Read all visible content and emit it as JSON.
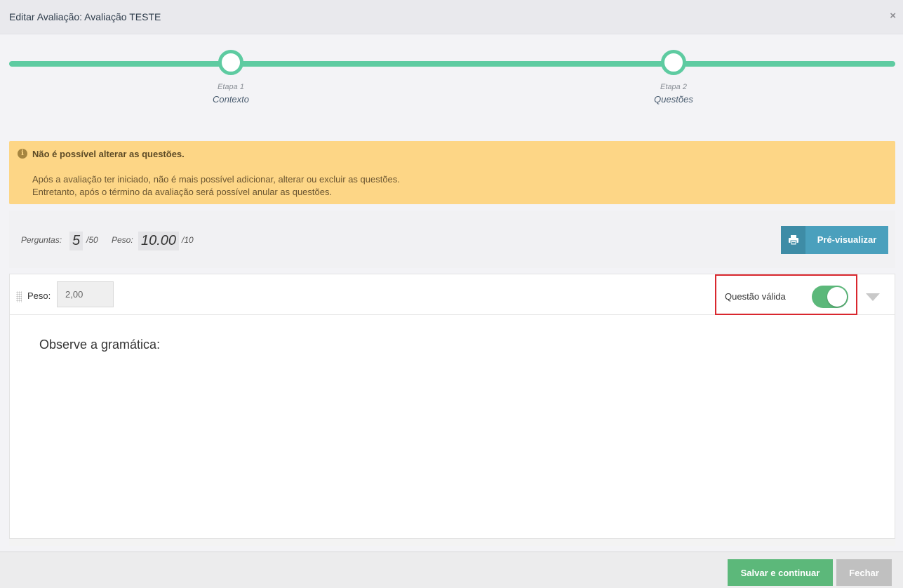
{
  "window": {
    "title": "Editar Avaliação: Avaliação TESTE",
    "close_symbol": "×",
    "close_icon": "close-icon"
  },
  "stepper": {
    "steps": [
      {
        "number": "Etapa 1",
        "name": "Contexto"
      },
      {
        "number": "Etapa 2",
        "name": "Questões"
      }
    ]
  },
  "alert": {
    "icon": "info-icon",
    "icon_symbol": "i",
    "heading": "Não é possível alterar as questões.",
    "line1": "Após a avaliação ter iniciado, não é mais possível adicionar, alterar ou excluir as questões.",
    "line2": "Entretanto, após o término da avaliação será possível anular as questões."
  },
  "stats": {
    "questions_label": "Perguntas:",
    "questions_value": "5",
    "questions_max": "/50",
    "weight_label": "Peso:",
    "weight_value": "10.00",
    "weight_max": "/10"
  },
  "toolbar": {
    "preview_label": "Pré-visualizar",
    "preview_icon": "printer-icon"
  },
  "question": {
    "weight_label": "Peso:",
    "weight_value": "2,00",
    "valid_label": "Questão válida",
    "valid_on": true,
    "text": "Observe a gramática:"
  },
  "footer": {
    "save_label": "Salvar e continuar",
    "close_label": "Fechar"
  },
  "colors": {
    "accent_green": "#5ecba1",
    "button_green": "#5cb87a",
    "alert_bg": "#fdd686",
    "preview_blue": "#4aa0bd",
    "highlight_red": "#d9272e"
  }
}
